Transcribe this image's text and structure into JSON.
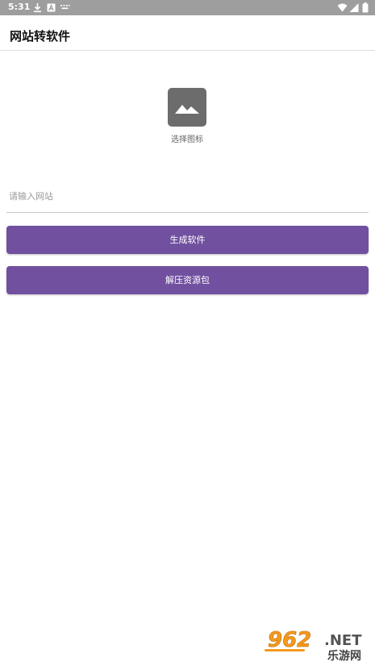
{
  "status_bar": {
    "time": "5:31",
    "left_icons": [
      "download-icon",
      "a-badge-icon",
      "keyboard-icon"
    ],
    "right_icons": [
      "wifi-icon",
      "signal-icon",
      "battery-icon"
    ]
  },
  "app_bar": {
    "title": "网站转软件"
  },
  "icon_picker": {
    "icon": "image-placeholder-icon",
    "caption": "选择图标"
  },
  "url_field": {
    "value": "",
    "placeholder": "请输入网站"
  },
  "buttons": {
    "generate_label": "生成软件",
    "extract_label": "解压资源包"
  },
  "watermark": {
    "number": "962",
    "suffix": ".NET",
    "cn_text": "乐游网"
  },
  "colors": {
    "status_bar": "#9e9e9e",
    "accent": "#7150a0",
    "icon_tile": "#6c6c6c",
    "watermark_orange": "#f39a1e"
  }
}
